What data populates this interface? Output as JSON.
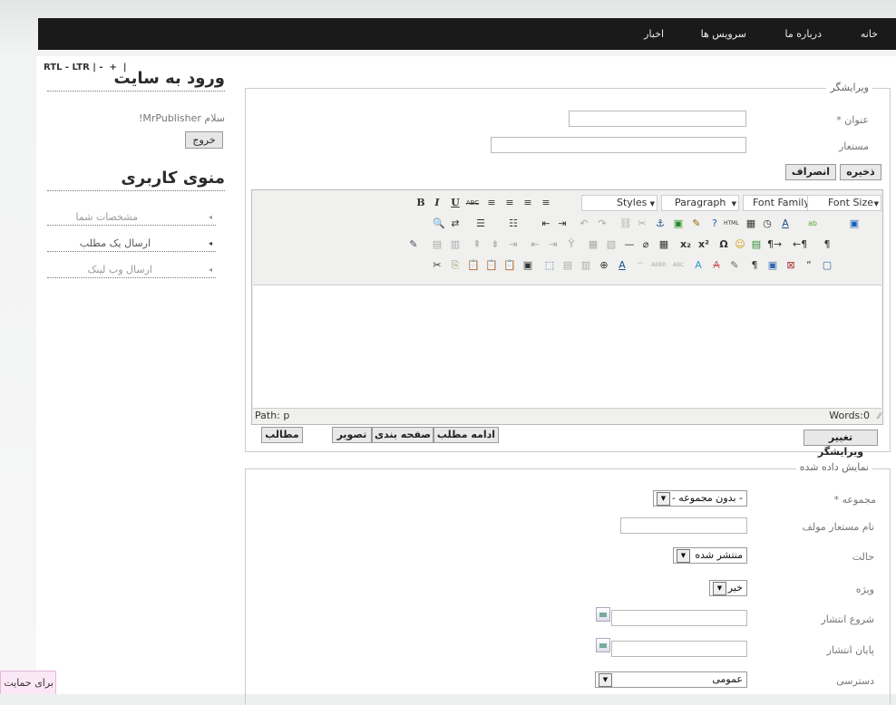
{
  "nav": {
    "items": [
      "خانه",
      "درباره ما",
      "سرویس ها",
      "اخبار"
    ]
  },
  "sidebar": {
    "dir_toggle": "RTL - LTR | -  +  |",
    "login_title": "ورود به سایت",
    "greeting": "سلام MrPublisher!",
    "logout_label": "خروج",
    "menu_title": "منوی کاربری",
    "menu_items": [
      "مشخصات شما",
      "ارسال یک مطلب",
      "ارسال وب لینک"
    ]
  },
  "editor_fs": {
    "legend": "ویرایشگر",
    "title_label": "عنوان *",
    "alias_label": "مستعار",
    "save_label": "ذخیره",
    "cancel_label": "انصراف",
    "selects": {
      "styles": "Styles",
      "paragraph": "Paragraph",
      "font_family": "Font Family",
      "font_size": "Font Size"
    },
    "path": "Path: p",
    "words": "Words:0",
    "toggle_editor": "تغییر ویرایشگر",
    "bottom_buttons": [
      "ادامه مطلب",
      "صفحه بندی",
      "تصویر",
      "مطالب"
    ]
  },
  "display_fs": {
    "legend": "نمایش داده شده",
    "fields": {
      "section": {
        "label": "مجموعه *",
        "value": "- بدون مجموعه -"
      },
      "author_alias": {
        "label": "نام مستعار مولف"
      },
      "state": {
        "label": "حالت",
        "value": "منتشر شده"
      },
      "featured": {
        "label": "ویژه",
        "value": "خیر"
      },
      "publish_up": {
        "label": "شروع انتشار"
      },
      "publish_down": {
        "label": "پایان انتشار"
      },
      "access": {
        "label": "دسترسی",
        "value": "عمومی"
      }
    }
  },
  "support_tab": "برای حمایت"
}
